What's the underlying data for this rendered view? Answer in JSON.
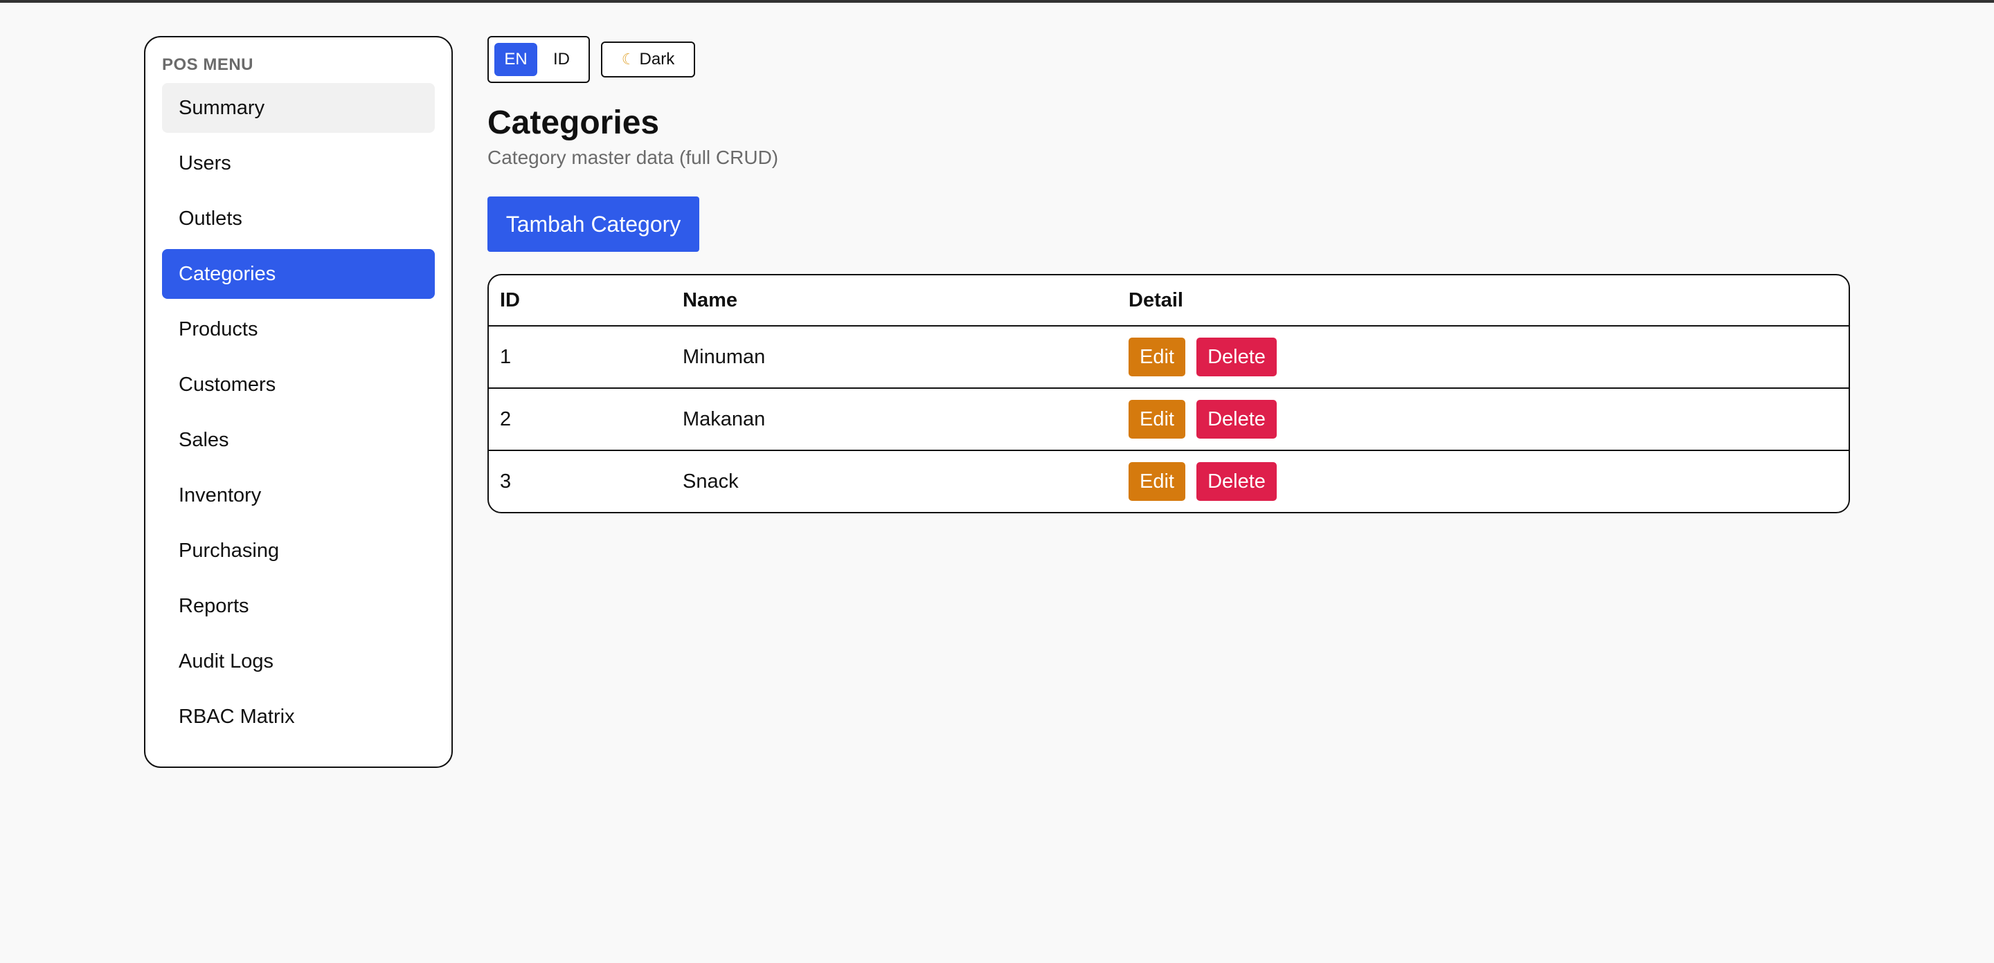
{
  "sidebar": {
    "title": "POS MENU",
    "items": [
      {
        "label": "Summary",
        "state": "hover"
      },
      {
        "label": "Users",
        "state": ""
      },
      {
        "label": "Outlets",
        "state": ""
      },
      {
        "label": "Categories",
        "state": "active"
      },
      {
        "label": "Products",
        "state": ""
      },
      {
        "label": "Customers",
        "state": ""
      },
      {
        "label": "Sales",
        "state": ""
      },
      {
        "label": "Inventory",
        "state": ""
      },
      {
        "label": "Purchasing",
        "state": ""
      },
      {
        "label": "Reports",
        "state": ""
      },
      {
        "label": "Audit Logs",
        "state": ""
      },
      {
        "label": "RBAC Matrix",
        "state": ""
      }
    ]
  },
  "toolbar": {
    "lang_en": "EN",
    "lang_id": "ID",
    "theme_icon": "moon-icon",
    "theme_label": "Dark"
  },
  "header": {
    "title": "Categories",
    "subtitle": "Category master data (full CRUD)"
  },
  "actions": {
    "add_label": "Tambah Category"
  },
  "table": {
    "columns": [
      "ID",
      "Name",
      "Detail"
    ],
    "rows": [
      {
        "id": "1",
        "name": "Minuman",
        "edit": "Edit",
        "delete": "Delete"
      },
      {
        "id": "2",
        "name": "Makanan",
        "edit": "Edit",
        "delete": "Delete"
      },
      {
        "id": "3",
        "name": "Snack",
        "edit": "Edit",
        "delete": "Delete"
      }
    ]
  },
  "colors": {
    "accent": "#2f5bea",
    "edit": "#d57a0e",
    "delete": "#de1f4b"
  }
}
